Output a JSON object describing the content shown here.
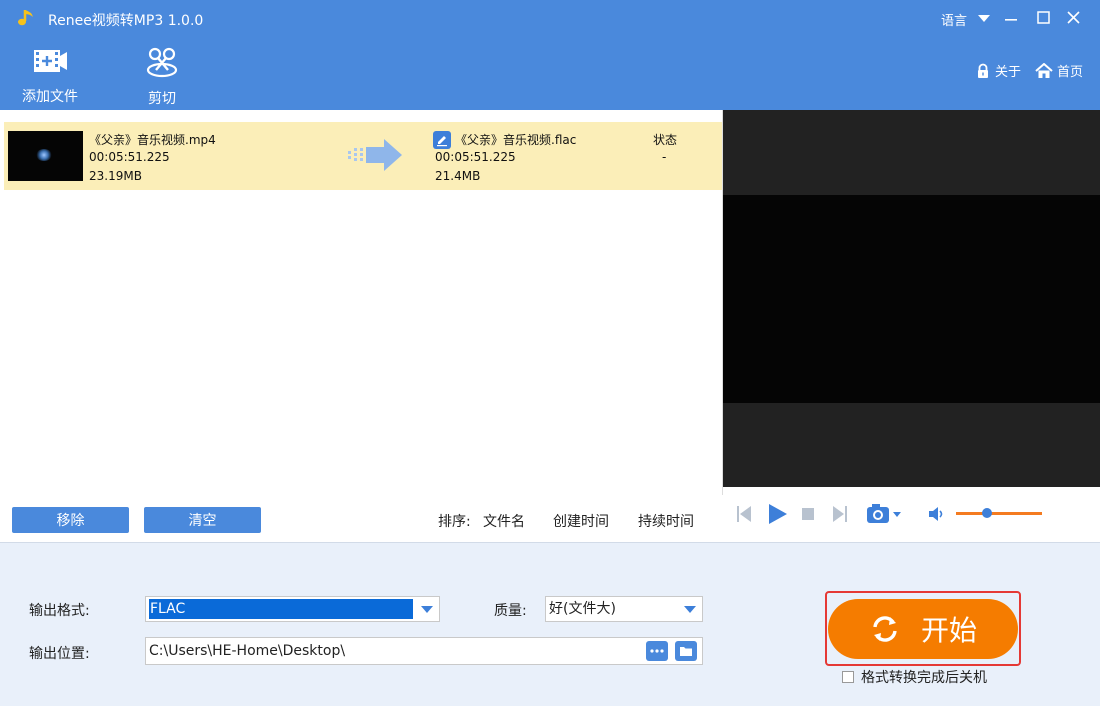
{
  "titlebar": {
    "title": "Renee视频转MP3 1.0.0",
    "language": "语言"
  },
  "toolbar": {
    "add_file": "添加文件",
    "cut": "剪切",
    "about": "关于",
    "home": "首页"
  },
  "file": {
    "source_name": "《父亲》音乐视频.mp4",
    "source_duration": "00:05:51.225",
    "source_size": "23.19MB",
    "output_name": "《父亲》音乐视频.flac",
    "output_duration": "00:05:51.225",
    "output_size": "21.4MB",
    "status_label": "状态",
    "status_value": "-"
  },
  "list_actions": {
    "remove": "移除",
    "clear": "清空",
    "sort_label": "排序:",
    "sort_name": "文件名",
    "sort_created": "创建时间",
    "sort_duration": "持续时间"
  },
  "settings": {
    "format_label": "输出格式:",
    "format_value": "FLAC",
    "quality_label": "质量:",
    "quality_value": "好(文件大)",
    "location_label": "输出位置:",
    "location_value": "C:\\Users\\HE-Home\\Desktop\\",
    "start": "开始",
    "shutdown_label": "格式转换完成后关机"
  },
  "player": {
    "volume": 0.36
  },
  "colors": {
    "accent": "#4a89dc",
    "start": "#f57c00",
    "row_highlight": "#fbeeb8"
  },
  "icons": [
    "app-note-icon",
    "add-file-icon",
    "cut-icon",
    "lock-icon",
    "home-icon",
    "edit-icon",
    "convert-arrow-icon",
    "prev-icon",
    "play-icon",
    "stop-icon",
    "next-icon",
    "camera-icon",
    "volume-icon",
    "refresh-icon",
    "more-icon",
    "folder-icon"
  ]
}
